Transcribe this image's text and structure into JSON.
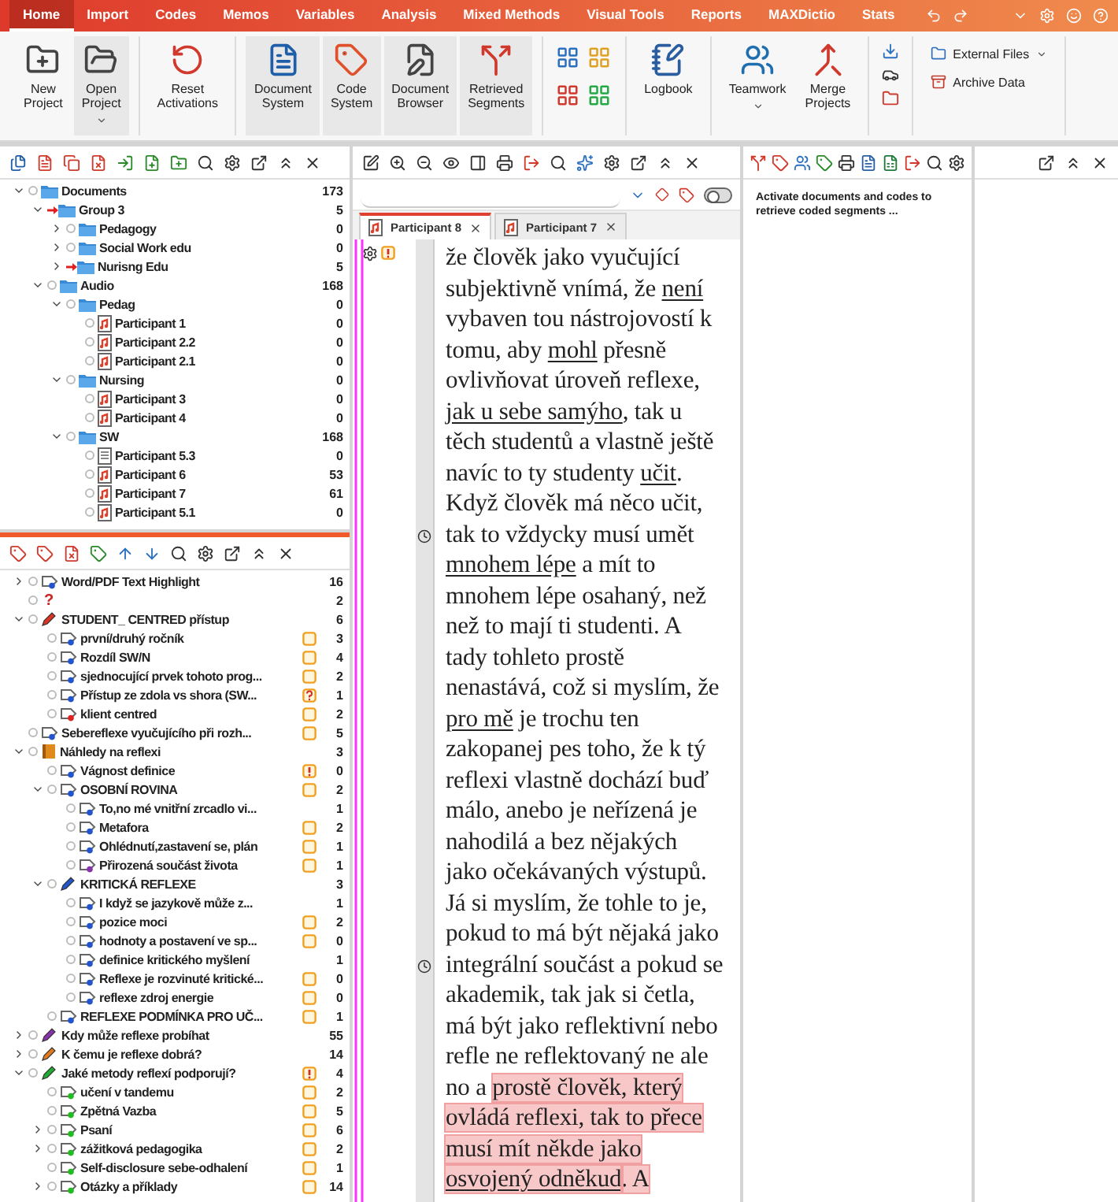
{
  "ribbon": {
    "tabs": [
      {
        "label": "Home",
        "selected": true
      },
      {
        "label": "Import",
        "selected": false
      },
      {
        "label": "Codes",
        "selected": false
      },
      {
        "label": "Memos",
        "selected": false
      },
      {
        "label": "Variables",
        "selected": false
      },
      {
        "label": "Analysis",
        "selected": false
      },
      {
        "label": "Mixed Methods",
        "selected": false
      },
      {
        "label": "Visual Tools",
        "selected": false
      },
      {
        "label": "Reports",
        "selected": false
      },
      {
        "label": "MAXDictio",
        "selected": false
      },
      {
        "label": "Stats",
        "selected": false
      }
    ],
    "groups": [
      [
        {
          "label": "New Project",
          "menu": false,
          "active": false
        },
        {
          "label": "Open Project",
          "menu": true,
          "active": true
        }
      ],
      [
        {
          "label": "Reset Activations",
          "menu": false,
          "active": false
        }
      ],
      [
        {
          "label": "Document System",
          "menu": false,
          "active": true
        },
        {
          "label": "Code System",
          "menu": false,
          "active": true
        },
        {
          "label": "Document Browser",
          "menu": false,
          "active": true
        },
        {
          "label": "Retrieved Segments",
          "menu": false,
          "active": true
        }
      ],
      [
        {
          "label": "Logbook",
          "menu": false,
          "active": false
        }
      ],
      [
        {
          "label": "Teamwork",
          "menu": true,
          "active": false
        },
        {
          "label": "Merge Projects",
          "menu": false,
          "active": false
        }
      ],
      [
        {
          "label": "External Files",
          "menu": true,
          "active": false
        },
        {
          "label": "Archive Data",
          "menu": false,
          "active": false
        }
      ]
    ]
  },
  "document_system": {
    "tree": [
      {
        "label": "Documents",
        "kind": "folder",
        "activated": false,
        "count": "173",
        "expanded": true,
        "children": [
          {
            "label": "Group 3",
            "kind": "folder",
            "activated": true,
            "count": "5",
            "expanded": true,
            "children": [
              {
                "label": "Pedagogy",
                "kind": "folder",
                "activated": false,
                "count": "0",
                "expanded": false
              },
              {
                "label": "Social Work edu",
                "kind": "folder",
                "activated": false,
                "count": "0",
                "expanded": false
              },
              {
                "label": "Nurisng Edu",
                "kind": "folder",
                "activated": true,
                "count": "5",
                "expanded": false
              }
            ]
          },
          {
            "label": "Audio",
            "kind": "folder",
            "activated": false,
            "count": "168",
            "expanded": true,
            "children": [
              {
                "label": "Pedag",
                "kind": "folder",
                "activated": false,
                "count": "0",
                "expanded": true,
                "children": [
                  {
                    "label": "Participant 1",
                    "kind": "audio",
                    "activated": false,
                    "count": "0"
                  },
                  {
                    "label": "Participant 2.2",
                    "kind": "audio",
                    "activated": false,
                    "count": "0"
                  },
                  {
                    "label": "Participant 2.1",
                    "kind": "audio",
                    "activated": false,
                    "count": "0"
                  }
                ]
              },
              {
                "label": "Nursing",
                "kind": "folder",
                "activated": false,
                "count": "0",
                "expanded": true,
                "children": [
                  {
                    "label": "Participant 3",
                    "kind": "audio",
                    "activated": false,
                    "count": "0"
                  },
                  {
                    "label": "Participant 4",
                    "kind": "audio",
                    "activated": false,
                    "count": "0"
                  }
                ]
              },
              {
                "label": "SW",
                "kind": "folder",
                "activated": false,
                "count": "168",
                "expanded": true,
                "children": [
                  {
                    "label": "Participant 5.3",
                    "kind": "text",
                    "activated": false,
                    "count": "0"
                  },
                  {
                    "label": "Participant 6",
                    "kind": "audio",
                    "activated": false,
                    "count": "53"
                  },
                  {
                    "label": "Participant 7",
                    "kind": "audio",
                    "activated": false,
                    "count": "61"
                  },
                  {
                    "label": "Participant 5.1",
                    "kind": "audio",
                    "activated": false,
                    "count": "0"
                  }
                ]
              }
            ]
          }
        ]
      }
    ]
  },
  "code_system": {
    "tree": [
      {
        "label": "Word/PDF Text Highlight",
        "kind": "code",
        "color": "#2255cc",
        "count": "16",
        "expanded": false
      },
      {
        "label": "?",
        "kind": "plain",
        "color": "#cc2222",
        "count": "2"
      },
      {
        "label": "STUDENT_ CENTRED přístup",
        "kind": "set",
        "color": "#dd3322",
        "count": "6",
        "expanded": true,
        "children": [
          {
            "label": "první/druhý ročník",
            "kind": "code",
            "color": "#2255cc",
            "memo": {
              "kind": "note"
            },
            "count": "3"
          },
          {
            "label": "Rozdíl SW/N",
            "kind": "code",
            "color": "#2255cc",
            "memo": {
              "kind": "note"
            },
            "count": "4"
          },
          {
            "label": "sjednocující prvek tohoto prog...",
            "kind": "code",
            "color": "#2255cc",
            "memo": {
              "kind": "note"
            },
            "count": "2"
          },
          {
            "label": "Přístup ze zdola vs shora (SW...",
            "kind": "code",
            "color": "#2255cc",
            "memo": {
              "kind": "question"
            },
            "count": "1"
          },
          {
            "label": "klient centred",
            "kind": "code",
            "color": "#dd2222",
            "memo": {
              "kind": "note"
            },
            "count": "2"
          }
        ]
      },
      {
        "label": "Sebereflexe vyučujícího při rozh...",
        "kind": "code",
        "color": "#2255cc",
        "memo": {
          "kind": "note"
        },
        "count": "5"
      },
      {
        "label": "Náhledy na reflexi",
        "kind": "category",
        "color": "#e08a1e",
        "count": "3",
        "expanded": true,
        "children": [
          {
            "label": "Vágnost definice",
            "kind": "code",
            "color": "#2255cc",
            "memo": {
              "kind": "alert"
            },
            "count": "0"
          },
          {
            "label": "OSOBNÍ ROVINA",
            "kind": "code",
            "color": "#2255cc",
            "memo": {
              "kind": "note"
            },
            "count": "2",
            "expanded": true,
            "children": [
              {
                "label": "To,no mé vnitřní zrcadlo vi...",
                "kind": "code",
                "color": "#2255cc",
                "count": "1"
              },
              {
                "label": "Metafora",
                "kind": "code",
                "color": "#2255cc",
                "memo": {
                  "kind": "note"
                },
                "count": "2"
              },
              {
                "label": "Ohlédnutí,zastavení se, plán",
                "kind": "code",
                "color": "#2255cc",
                "memo": {
                  "kind": "note"
                },
                "count": "1"
              },
              {
                "label": "Přirozená součást života",
                "kind": "code",
                "color": "#8833aa",
                "memo": {
                  "kind": "note"
                },
                "count": "1"
              }
            ]
          },
          {
            "label": "KRITICKÁ REFLEXE",
            "kind": "set",
            "color": "#2255cc",
            "count": "3",
            "expanded": true,
            "children": [
              {
                "label": "I když se jazykově může z...",
                "kind": "code",
                "color": "#2255cc",
                "count": "1"
              },
              {
                "label": "pozice moci",
                "kind": "code",
                "color": "#2255cc",
                "memo": {
                  "kind": "note"
                },
                "count": "2"
              },
              {
                "label": "hodnoty a postavení ve sp...",
                "kind": "code",
                "color": "#2255cc",
                "memo": {
                  "kind": "note"
                },
                "count": "0"
              },
              {
                "label": "definice kritického myšlení",
                "kind": "code",
                "color": "#2255cc",
                "count": "1"
              },
              {
                "label": "Reflexe je rozvinuté kritické...",
                "kind": "code",
                "color": "#2255cc",
                "memo": {
                  "kind": "note"
                },
                "count": "0"
              },
              {
                "label": "reflexe zdroj  energie",
                "kind": "code",
                "color": "#2255cc",
                "memo": {
                  "kind": "note"
                },
                "count": "0"
              }
            ]
          },
          {
            "label": "REFLEXE PODMÍNKA PRO UČ...",
            "kind": "code",
            "color": "#2255cc",
            "memo": {
              "kind": "note"
            },
            "count": "1"
          }
        ]
      },
      {
        "label": "Kdy může reflexe probíhat",
        "kind": "set",
        "color": "#8833aa",
        "count": "55",
        "expanded": false
      },
      {
        "label": "K čemu je reflexe dobrá?",
        "kind": "set",
        "color": "#e07a1e",
        "count": "14",
        "expanded": false
      },
      {
        "label": "Jaké metody reflexí podporují?",
        "kind": "set",
        "color": "#22aa33",
        "memo": {
          "kind": "alert"
        },
        "count": "4",
        "expanded": true,
        "children": [
          {
            "label": "učení v tandemu",
            "kind": "code",
            "color": "#22bb22",
            "memo": {
              "kind": "note"
            },
            "count": "2"
          },
          {
            "label": "Zpětná Vazba",
            "kind": "code",
            "color": "#22bb22",
            "memo": {
              "kind": "note"
            },
            "count": "5"
          },
          {
            "label": "Psaní",
            "kind": "code",
            "color": "#22bb22",
            "memo": {
              "kind": "note"
            },
            "count": "6",
            "expanded": false
          },
          {
            "label": "zážitková pedagogika",
            "kind": "code",
            "color": "#22bb22",
            "memo": {
              "kind": "note"
            },
            "count": "2",
            "expanded": false
          },
          {
            "label": "Self-disclosure sebe-odhalení",
            "kind": "code",
            "color": "#22bb22",
            "memo": {
              "kind": "note"
            },
            "count": "1"
          },
          {
            "label": "Otázky a příklady",
            "kind": "code",
            "color": "#22bb22",
            "memo": {
              "kind": "note"
            },
            "count": "14",
            "expanded": false
          }
        ]
      }
    ]
  },
  "document_browser": {
    "toggle": {
      "on": false
    },
    "tabs": [
      {
        "label": "Participant 8",
        "selected": true
      },
      {
        "label": "Participant 7",
        "selected": false
      }
    ],
    "lines": [
      {
        "clock": false,
        "segments": [
          {
            "text": "že člověk jako vyučující",
            "kind": "plain"
          }
        ]
      },
      {
        "clock": false,
        "segments": [
          {
            "text": "subjektivně vnímá, že ",
            "kind": "plain"
          },
          {
            "text": "není",
            "kind": "underline"
          }
        ]
      },
      {
        "clock": false,
        "segments": [
          {
            "text": "vybaven tou nástrojovostí k",
            "kind": "plain"
          }
        ]
      },
      {
        "clock": false,
        "segments": [
          {
            "text": "tomu, aby ",
            "kind": "plain"
          },
          {
            "text": "mohl",
            "kind": "underline"
          },
          {
            "text": " přesně",
            "kind": "plain"
          }
        ]
      },
      {
        "clock": false,
        "segments": [
          {
            "text": "ovlivňovat úroveň reflexe,",
            "kind": "plain"
          }
        ]
      },
      {
        "clock": false,
        "segments": [
          {
            "text": "jak u sebe samýho",
            "kind": "underline"
          },
          {
            "text": ", tak u",
            "kind": "plain"
          }
        ]
      },
      {
        "clock": false,
        "segments": [
          {
            "text": "těch studentů a vlastně ještě",
            "kind": "plain"
          }
        ]
      },
      {
        "clock": false,
        "segments": [
          {
            "text": "navíc to ty studenty ",
            "kind": "plain"
          },
          {
            "text": "učit",
            "kind": "underline"
          },
          {
            "text": ".",
            "kind": "plain"
          }
        ]
      },
      {
        "clock": false,
        "segments": [
          {
            "text": "Když člověk má něco učit,",
            "kind": "plain"
          }
        ]
      },
      {
        "clock": true,
        "segments": [
          {
            "text": "tak to vždycky musí umět",
            "kind": "plain"
          }
        ]
      },
      {
        "clock": false,
        "segments": [
          {
            "text": "mnohem lépe",
            "kind": "underline"
          },
          {
            "text": " a mít to",
            "kind": "plain"
          }
        ]
      },
      {
        "clock": false,
        "segments": [
          {
            "text": "mnohem lépe osahaný, než",
            "kind": "plain"
          }
        ]
      },
      {
        "clock": false,
        "segments": [
          {
            "text": "než to mají ti studenti. A",
            "kind": "plain"
          }
        ]
      },
      {
        "clock": false,
        "segments": [
          {
            "text": "tady tohleto prostě",
            "kind": "plain"
          }
        ]
      },
      {
        "clock": false,
        "segments": [
          {
            "text": "nenastává, což si myslím, že",
            "kind": "plain"
          }
        ]
      },
      {
        "clock": false,
        "segments": [
          {
            "text": "pro mě",
            "kind": "underline"
          },
          {
            "text": " je trochu ten",
            "kind": "plain"
          }
        ]
      },
      {
        "clock": false,
        "segments": [
          {
            "text": "zakopanej pes toho, že k tý",
            "kind": "plain"
          }
        ]
      },
      {
        "clock": false,
        "segments": [
          {
            "text": "reflexi vlastně dochází buď",
            "kind": "plain"
          }
        ]
      },
      {
        "clock": false,
        "segments": [
          {
            "text": "málo, anebo je neřízená je",
            "kind": "plain"
          }
        ]
      },
      {
        "clock": false,
        "segments": [
          {
            "text": "nahodilá a bez nějakých",
            "kind": "plain"
          }
        ]
      },
      {
        "clock": false,
        "segments": [
          {
            "text": "jako očekávaných výstupů.",
            "kind": "plain"
          }
        ]
      },
      {
        "clock": false,
        "segments": [
          {
            "text": "Já si myslím, že tohle to je,",
            "kind": "plain"
          }
        ]
      },
      {
        "clock": false,
        "segments": [
          {
            "text": "pokud to má být nějaká jako",
            "kind": "plain"
          }
        ]
      },
      {
        "clock": true,
        "segments": [
          {
            "text": "integrální součást a pokud se",
            "kind": "plain"
          }
        ]
      },
      {
        "clock": false,
        "segments": [
          {
            "text": "akademik, tak jak si četla,",
            "kind": "plain"
          }
        ]
      },
      {
        "clock": false,
        "segments": [
          {
            "text": "má být jako reflektivní nebo",
            "kind": "plain"
          }
        ]
      },
      {
        "clock": false,
        "segments": [
          {
            "text": "refle ne reflektovaný ne ale",
            "kind": "plain"
          }
        ]
      },
      {
        "clock": false,
        "segments": [
          {
            "text": "no a ",
            "kind": "plain"
          },
          {
            "text": "prostě člověk, který",
            "kind": "highlight"
          }
        ]
      },
      {
        "clock": false,
        "segments": [
          {
            "text": "ovládá reflexi, tak to přece",
            "kind": "highlight"
          }
        ]
      },
      {
        "clock": false,
        "segments": [
          {
            "text": "musí mít někde jako",
            "kind": "highlight"
          }
        ]
      },
      {
        "clock": false,
        "segments": [
          {
            "text": "osvojený odněkud",
            "kind": "highlight-underline"
          },
          {
            "text": ". A",
            "kind": "highlight"
          }
        ]
      }
    ]
  },
  "retrieved_segments": {
    "message": "Activate documents and codes to retrieve coded segments ..."
  }
}
